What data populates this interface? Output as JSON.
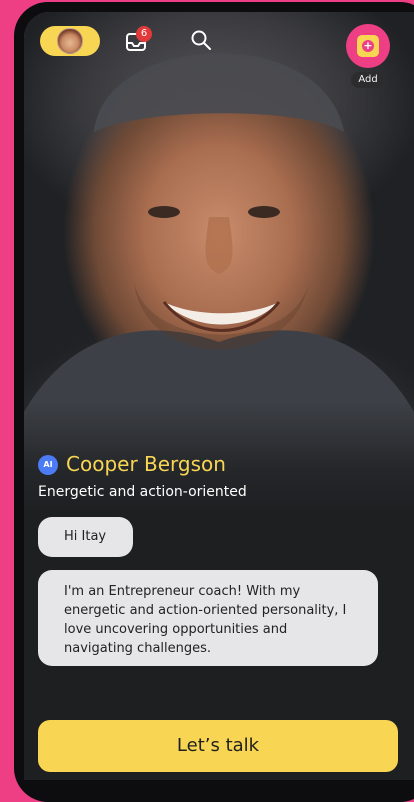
{
  "header": {
    "notification_count": "6",
    "add_label": "Add"
  },
  "profile": {
    "ai_badge": "AI",
    "name": "Cooper Bergson",
    "tagline": "Energetic and action-oriented"
  },
  "chat": {
    "messages": [
      "Hi Itay",
      "I'm an Entrepreneur coach! With my energetic and action-oriented personality, I love uncovering opportunities and navigating challenges."
    ]
  },
  "cta": {
    "label": "Let’s talk"
  },
  "colors": {
    "accent_yellow": "#f8d553",
    "accent_pink": "#ee3f84",
    "badge_red": "#e23a3a",
    "ai_blue": "#4b7bf5"
  },
  "icons": {
    "avatar": "user-avatar-icon",
    "inbox": "inbox-icon",
    "search": "search-icon",
    "add": "add-icon"
  }
}
